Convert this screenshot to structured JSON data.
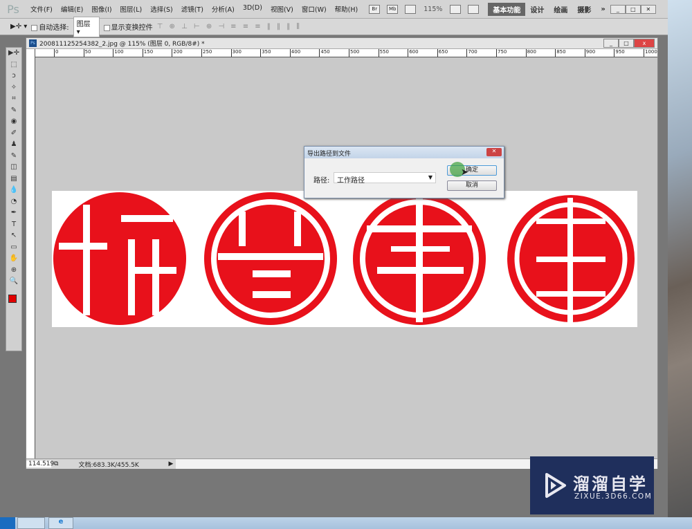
{
  "app": {
    "logo": "Ps"
  },
  "menu": [
    "文件(F)",
    "编辑(E)",
    "图像(I)",
    "图层(L)",
    "选择(S)",
    "滤镜(T)",
    "分析(A)",
    "3D(D)",
    "视图(V)",
    "窗口(W)",
    "帮助(H)"
  ],
  "appbar": {
    "br": "Br",
    "mb": "Mb",
    "zoom": "115%",
    "workspaces": [
      "基本功能",
      "设计",
      "绘画",
      "摄影"
    ],
    "more": "»"
  },
  "options": {
    "auto_select_label": "自动选择:",
    "auto_select_value": "图层",
    "show_transform_label": "显示变换控件",
    "align_icons": "⊤ ⊕ ⊥  ⊢ ⊕ ⊣",
    "dist_icons": "≡ ≡ ≡  ‖ ‖ ‖",
    "auto_align": "⫼"
  },
  "document": {
    "title": "200811125254382_2.jpg @ 115% (图层 0, RGB/8#) *",
    "ruler_ticks": [
      "0",
      "50",
      "100",
      "150",
      "200",
      "250",
      "300",
      "350",
      "400",
      "450",
      "500",
      "550",
      "600",
      "650",
      "700",
      "750",
      "800",
      "850",
      "900",
      "950",
      "1000"
    ]
  },
  "status": {
    "zoom": "114.519",
    "doc_info": "文档:683.3K/455.5K"
  },
  "dialog": {
    "title": "导出路径到文件",
    "path_label": "路径:",
    "path_value": "工作路径",
    "ok": "确定",
    "cancel": "取消"
  },
  "watermark": {
    "name": "溜溜自学",
    "url": "ZIXUE.3D66.COM"
  },
  "colors": {
    "seal_red": "#e8111b",
    "foreground": "#e00000",
    "background": "#ffffff"
  }
}
